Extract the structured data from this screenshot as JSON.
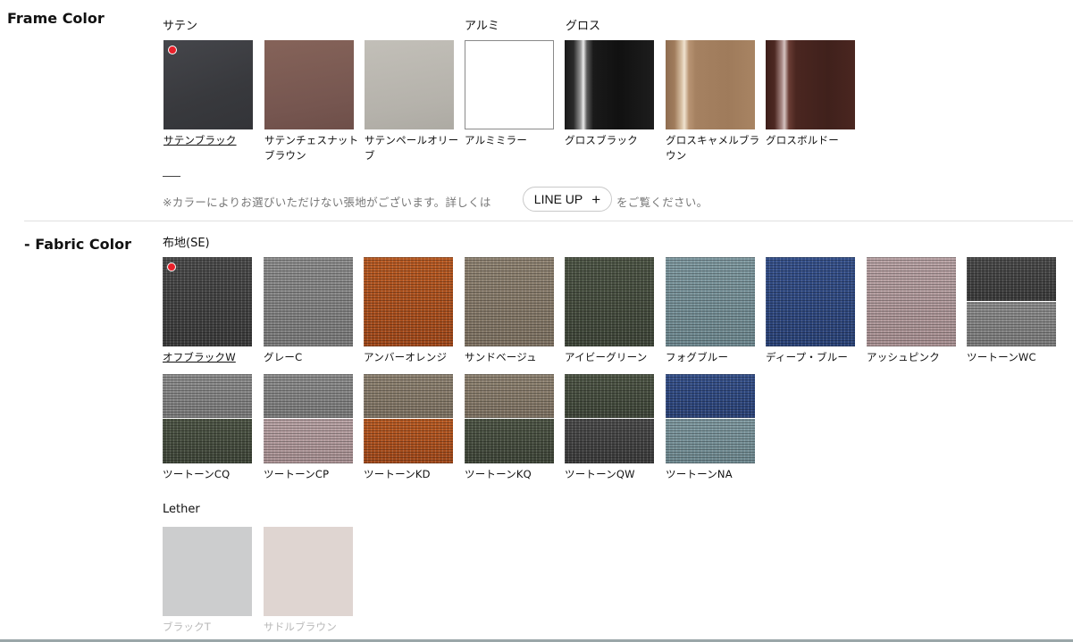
{
  "frame": {
    "title": "Frame Color",
    "groups": [
      {
        "label": "サテン"
      },
      {
        "label": "アルミ"
      },
      {
        "label": "グロス"
      }
    ],
    "swatches": [
      {
        "name": "サテンブラック",
        "selected": true
      },
      {
        "name": "サテンチェスナットブラウン"
      },
      {
        "name": "サテンペールオリーブ"
      },
      {
        "name": "アルミミラー"
      },
      {
        "name": "グロスブラック"
      },
      {
        "name": "グロスキャメルブラウン"
      },
      {
        "name": "グロスボルドー"
      }
    ],
    "note_before": "※カラーによりお選びいただけない張地がございます。詳しくは",
    "lineup_button": "LINE UP",
    "plus_icon": "+",
    "note_after": "をご覧ください。"
  },
  "fabric": {
    "title": "- Fabric Color",
    "group_label": "布地(SE)",
    "swatches": [
      {
        "name": "オフブラックW",
        "selected": true
      },
      {
        "name": "グレーC"
      },
      {
        "name": "アンバーオレンジ"
      },
      {
        "name": "サンドベージュ"
      },
      {
        "name": "アイビーグリーン"
      },
      {
        "name": "フォグブルー"
      },
      {
        "name": "ディープ・ブルー"
      },
      {
        "name": "アッシュピンク"
      },
      {
        "name": "ツートーンWC"
      },
      {
        "name": "ツートーンCQ"
      },
      {
        "name": "ツートーンCP"
      },
      {
        "name": "ツートーンKD"
      },
      {
        "name": "ツートーンKQ"
      },
      {
        "name": "ツートーンQW"
      },
      {
        "name": "ツートーンNA"
      }
    ],
    "leather_label": "Lether",
    "leather_swatches": [
      {
        "name": "ブラックT"
      },
      {
        "name": "サドルブラウン"
      }
    ]
  },
  "colors": {
    "selected_dot": "#e8202a",
    "satin_black": "#3d3e42",
    "satin_chestnut": "#7a5a52",
    "satin_pale_olive": "#b8b5ae",
    "alumi_mirror": "#ffffff",
    "gloss_black": "#111111",
    "gloss_camel": "#a78361",
    "gloss_bordeaux": "#4a2620"
  }
}
